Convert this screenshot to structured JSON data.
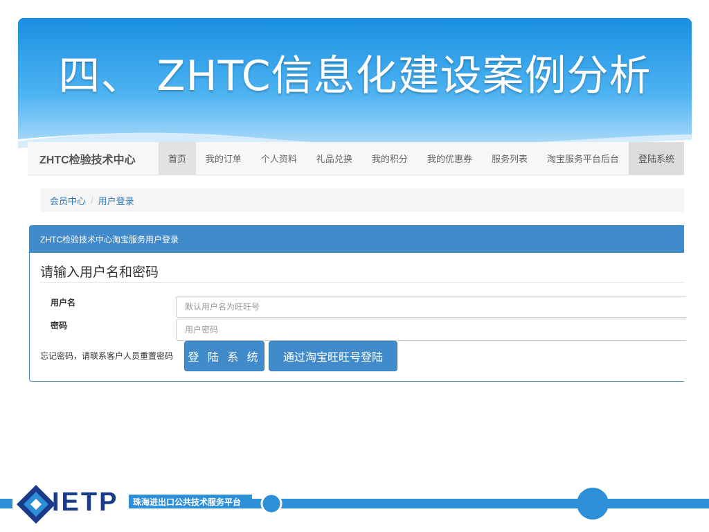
{
  "slide": {
    "title": "四、 ZHTC信息化建设案例分析"
  },
  "navbar": {
    "brand": "ZHTC检验技术中心",
    "items": [
      {
        "label": "首页",
        "active": true
      },
      {
        "label": "我的订单",
        "active": false
      },
      {
        "label": "个人资料",
        "active": false
      },
      {
        "label": "礼品兑换",
        "active": false
      },
      {
        "label": "我的积分",
        "active": false
      },
      {
        "label": "我的优惠券",
        "active": false
      },
      {
        "label": "服务列表",
        "active": false
      },
      {
        "label": "淘宝服务平台后台",
        "active": false
      }
    ],
    "login": "登陆系统"
  },
  "breadcrumb": {
    "items": [
      "会员中心",
      "用户登录"
    ],
    "separator": "/"
  },
  "panel": {
    "heading": "ZHTC检验技术中心淘宝服务用户登录",
    "form_title": "请输入用户名和密码",
    "username_label": "用户名",
    "username_placeholder": "默认用户名为旺旺号",
    "password_label": "密码",
    "password_placeholder": "用户密码",
    "forgot_text": "忘记密码，请联系客户人员重置密码",
    "login_button": "登 陆 系 统",
    "taobao_button": "通过淘宝旺旺号登陆"
  },
  "footer": {
    "logo_text": "IETP",
    "platform_text": "珠海进出口公共技术服务平台"
  },
  "colors": {
    "header_blue": "#2a9ee8",
    "primary": "#428bca",
    "footer_blue": "#2d8fd8"
  }
}
